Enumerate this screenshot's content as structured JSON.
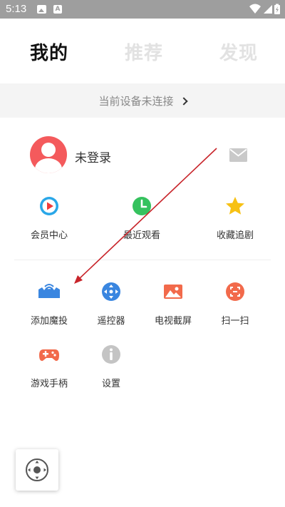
{
  "status_bar": {
    "time": "5:13",
    "icons": [
      "image-icon",
      "font-icon",
      "wifi-icon",
      "signal-icon",
      "battery-icon"
    ]
  },
  "tabs": [
    {
      "label": "我的",
      "active": true
    },
    {
      "label": "推荐",
      "active": false
    },
    {
      "label": "发现",
      "active": false
    }
  ],
  "connection": {
    "text": "当前设备未连接"
  },
  "profile": {
    "login_text": "未登录"
  },
  "shortcuts": [
    {
      "label": "会员中心",
      "icon": "vip-play-icon",
      "color": "#2aa7e8"
    },
    {
      "label": "最近观看",
      "icon": "clock-icon",
      "color": "#35c25e"
    },
    {
      "label": "收藏追剧",
      "icon": "star-icon",
      "color": "#f7c114"
    }
  ],
  "tools": [
    {
      "label": "添加魔投",
      "icon": "cast-device-icon",
      "color": "#3a86e0"
    },
    {
      "label": "遥控器",
      "icon": "remote-dpad-icon",
      "color": "#3a86e0"
    },
    {
      "label": "电视截屏",
      "icon": "screenshot-image-icon",
      "color": "#f26a4b"
    },
    {
      "label": "扫一扫",
      "icon": "scan-icon",
      "color": "#f26a4b"
    },
    {
      "label": "游戏手柄",
      "icon": "gamepad-icon",
      "color": "#f26a4b"
    },
    {
      "label": "设置",
      "icon": "info-settings-icon",
      "color": "#c4c4c4"
    }
  ],
  "colors": {
    "accent_blue": "#3a86e0",
    "accent_red": "#f26a4b",
    "annotation_arrow": "#c8242a",
    "status_bar": "#9e9e9e"
  }
}
